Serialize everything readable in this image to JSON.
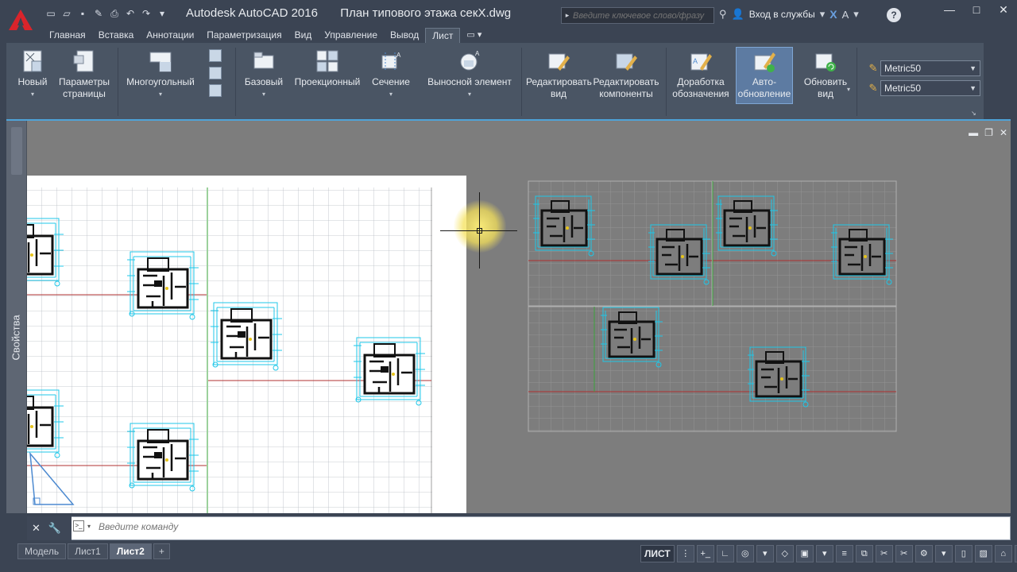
{
  "window": {
    "app_name": "Autodesk AutoCAD 2016",
    "file_name": "План типового этажа секX.dwg",
    "minimize": "—",
    "maximize": "□",
    "close": "✕"
  },
  "search": {
    "placeholder": "Введите ключевое слово/фразу"
  },
  "account": {
    "signin_label": "Вход в службы"
  },
  "ribbon_tabs": [
    "Главная",
    "Вставка",
    "Аннотации",
    "Параметризация",
    "Вид",
    "Управление",
    "Вывод",
    "Лист"
  ],
  "active_tab": "Лист",
  "ribbon": {
    "new": "Новый",
    "page_params_1": "Параметры",
    "page_params_2": "страницы",
    "polygonal": "Многоугольный",
    "base": "Базовый",
    "projection": "Проекционный",
    "section": "Сечение",
    "detail": "Выносной элемент",
    "edit_view_1": "Редактировать",
    "edit_view_2": "вид",
    "edit_comp_1": "Редактировать",
    "edit_comp_2": "компоненты",
    "symbol_1": "Доработка",
    "symbol_2": "обозначения",
    "auto_1": "Авто-",
    "auto_2": "обновление",
    "update_1": "Обновить",
    "update_2": "вид",
    "style_1": "Metric50",
    "style_2": "Metric50"
  },
  "palette": {
    "properties_label": "Свойства"
  },
  "command": {
    "placeholder": "Введите команду"
  },
  "layout_tabs": [
    "Модель",
    "Лист1",
    "Лист2"
  ],
  "active_layout": "Лист2",
  "status": {
    "mode": "ЛИСТ"
  },
  "colors": {
    "accent_blue": "#4ea3d8",
    "drawing_cyan": "#1fc7e8",
    "section_red": "#b03030"
  }
}
